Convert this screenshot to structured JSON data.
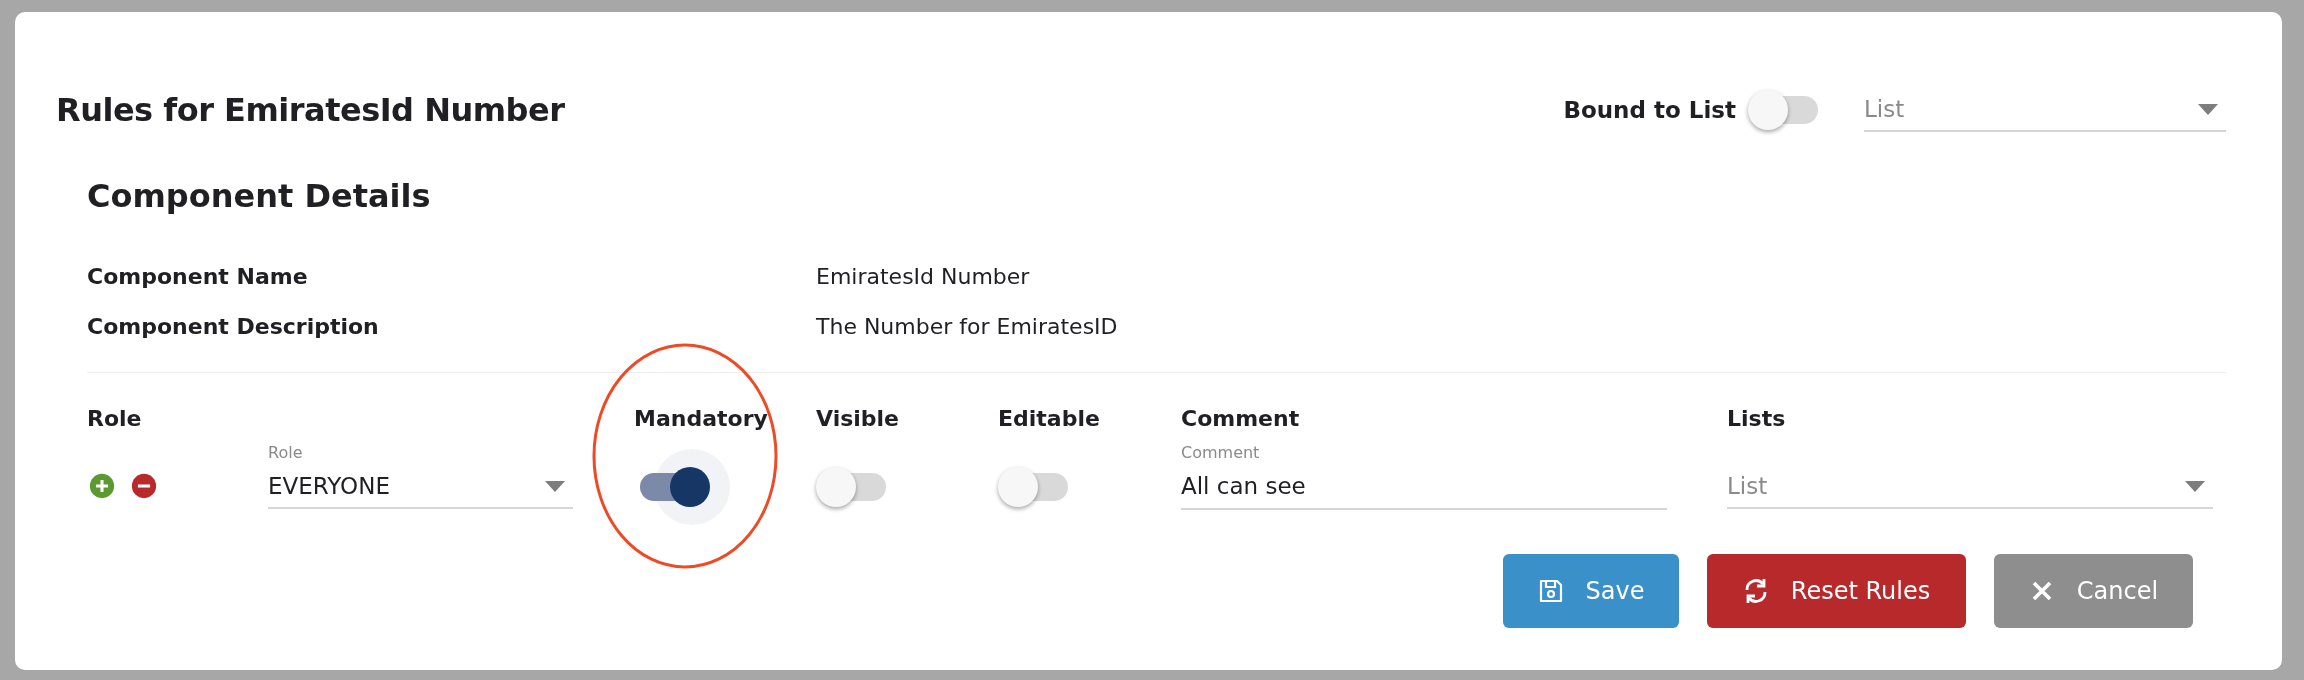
{
  "dialog": {
    "title": "Rules for EmiratesId Number",
    "bound_to_list": {
      "label": "Bound to List",
      "on": false
    },
    "list_select": {
      "placeholder": "List"
    }
  },
  "component_details": {
    "heading": "Component Details",
    "fields": [
      {
        "label": "Component Name",
        "value": "EmiratesId Number"
      },
      {
        "label": "Component Description",
        "value": "The Number for EmiratesID"
      }
    ]
  },
  "rules": {
    "columns": [
      "Role",
      "Mandatory",
      "Visible",
      "Editable",
      "Comment",
      "Lists"
    ],
    "rows": [
      {
        "role_label": "Role",
        "role": "EVERYONE",
        "mandatory": true,
        "visible": false,
        "editable": false,
        "comment_label": "Comment",
        "comment": "All can see",
        "lists_placeholder": "List"
      }
    ]
  },
  "buttons": [
    {
      "kind": "save",
      "label": "Save"
    },
    {
      "kind": "reset",
      "label": "Reset Rules"
    },
    {
      "kind": "cancel",
      "label": "Cancel"
    }
  ]
}
